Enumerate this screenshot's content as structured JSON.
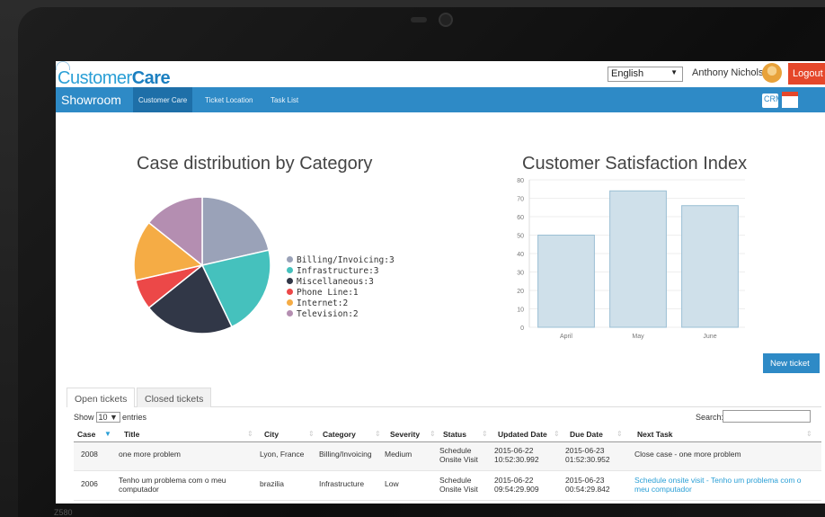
{
  "app": {
    "logo_part1": "Customer",
    "logo_part2": "Care",
    "brand": "Showroom"
  },
  "header": {
    "language": "English",
    "user_name": "Anthony Nichols",
    "logout_label": "Logout"
  },
  "nav": {
    "items": [
      {
        "label": "Customer Care"
      },
      {
        "label": "Ticket Location"
      },
      {
        "label": "Task List"
      }
    ],
    "icon_users_label": "CRM"
  },
  "pie": {
    "title": "Case distribution by Category",
    "legend": [
      {
        "label": "Billing/Invoicing:3",
        "color": "#9aa2b8"
      },
      {
        "label": "Infrastructure:3",
        "color": "#45c1bd"
      },
      {
        "label": "Miscellaneous:3",
        "color": "#313747"
      },
      {
        "label": "Phone Line:1",
        "color": "#ec4848"
      },
      {
        "label": "Internet:2",
        "color": "#f5ac45"
      },
      {
        "label": "Television:2",
        "color": "#b48eb1"
      }
    ]
  },
  "bar": {
    "title": "Customer Satisfaction Index"
  },
  "chart_data": [
    {
      "type": "pie",
      "title": "Case distribution by Category",
      "categories": [
        "Billing/Invoicing",
        "Infrastructure",
        "Miscellaneous",
        "Phone Line",
        "Internet",
        "Television"
      ],
      "values": [
        3,
        3,
        3,
        1,
        2,
        2
      ],
      "colors": [
        "#9aa2b8",
        "#45c1bd",
        "#313747",
        "#ec4848",
        "#f5ac45",
        "#b48eb1"
      ]
    },
    {
      "type": "bar",
      "title": "Customer Satisfaction Index",
      "categories": [
        "April",
        "May",
        "June"
      ],
      "values": [
        50,
        74,
        66
      ],
      "ylim": [
        0,
        80
      ],
      "yticks": [
        0,
        10,
        20,
        30,
        40,
        50,
        60,
        70,
        80
      ],
      "color": "#cfe0ea",
      "grid": true
    }
  ],
  "actions": {
    "new_ticket": "New ticket"
  },
  "tabs": [
    {
      "label": "Open tickets"
    },
    {
      "label": "Closed tickets"
    }
  ],
  "table_controls": {
    "show": "Show",
    "page_size": "10",
    "entries": "entries",
    "search": "Search:"
  },
  "table": {
    "headers": [
      "Case",
      "Title",
      "City",
      "Category",
      "Severity",
      "Status",
      "Updated Date",
      "Due Date",
      "Next Task"
    ],
    "rows": [
      {
        "case": "2008",
        "title": "one more problem",
        "title2": "",
        "city": "Lyon, France",
        "category": "Billing/Invoicing",
        "severity": "Medium",
        "status1": "Schedule",
        "status2": "Onsite Visit",
        "updated1": "2015-06-22",
        "updated2": "10:52:30.992",
        "due1": "2015-06-23",
        "due2": "01:52:30.952",
        "task1": "Close case - one more problem",
        "task2": ""
      },
      {
        "case": "2006",
        "title": "Tenho um problema com o meu",
        "title2": "computador",
        "city": "brazilia",
        "category": "Infrastructure",
        "severity": "Low",
        "status1": "Schedule",
        "status2": "Onsite Visit",
        "updated1": "2015-06-22",
        "updated2": "09:54:29.909",
        "due1": "2015-06-23",
        "due2": "00:54:29.842",
        "task1": "Schedule onsite visit - Tenho um problema com o",
        "task2": "meu computador"
      }
    ]
  },
  "device": {
    "model": "Z580"
  }
}
